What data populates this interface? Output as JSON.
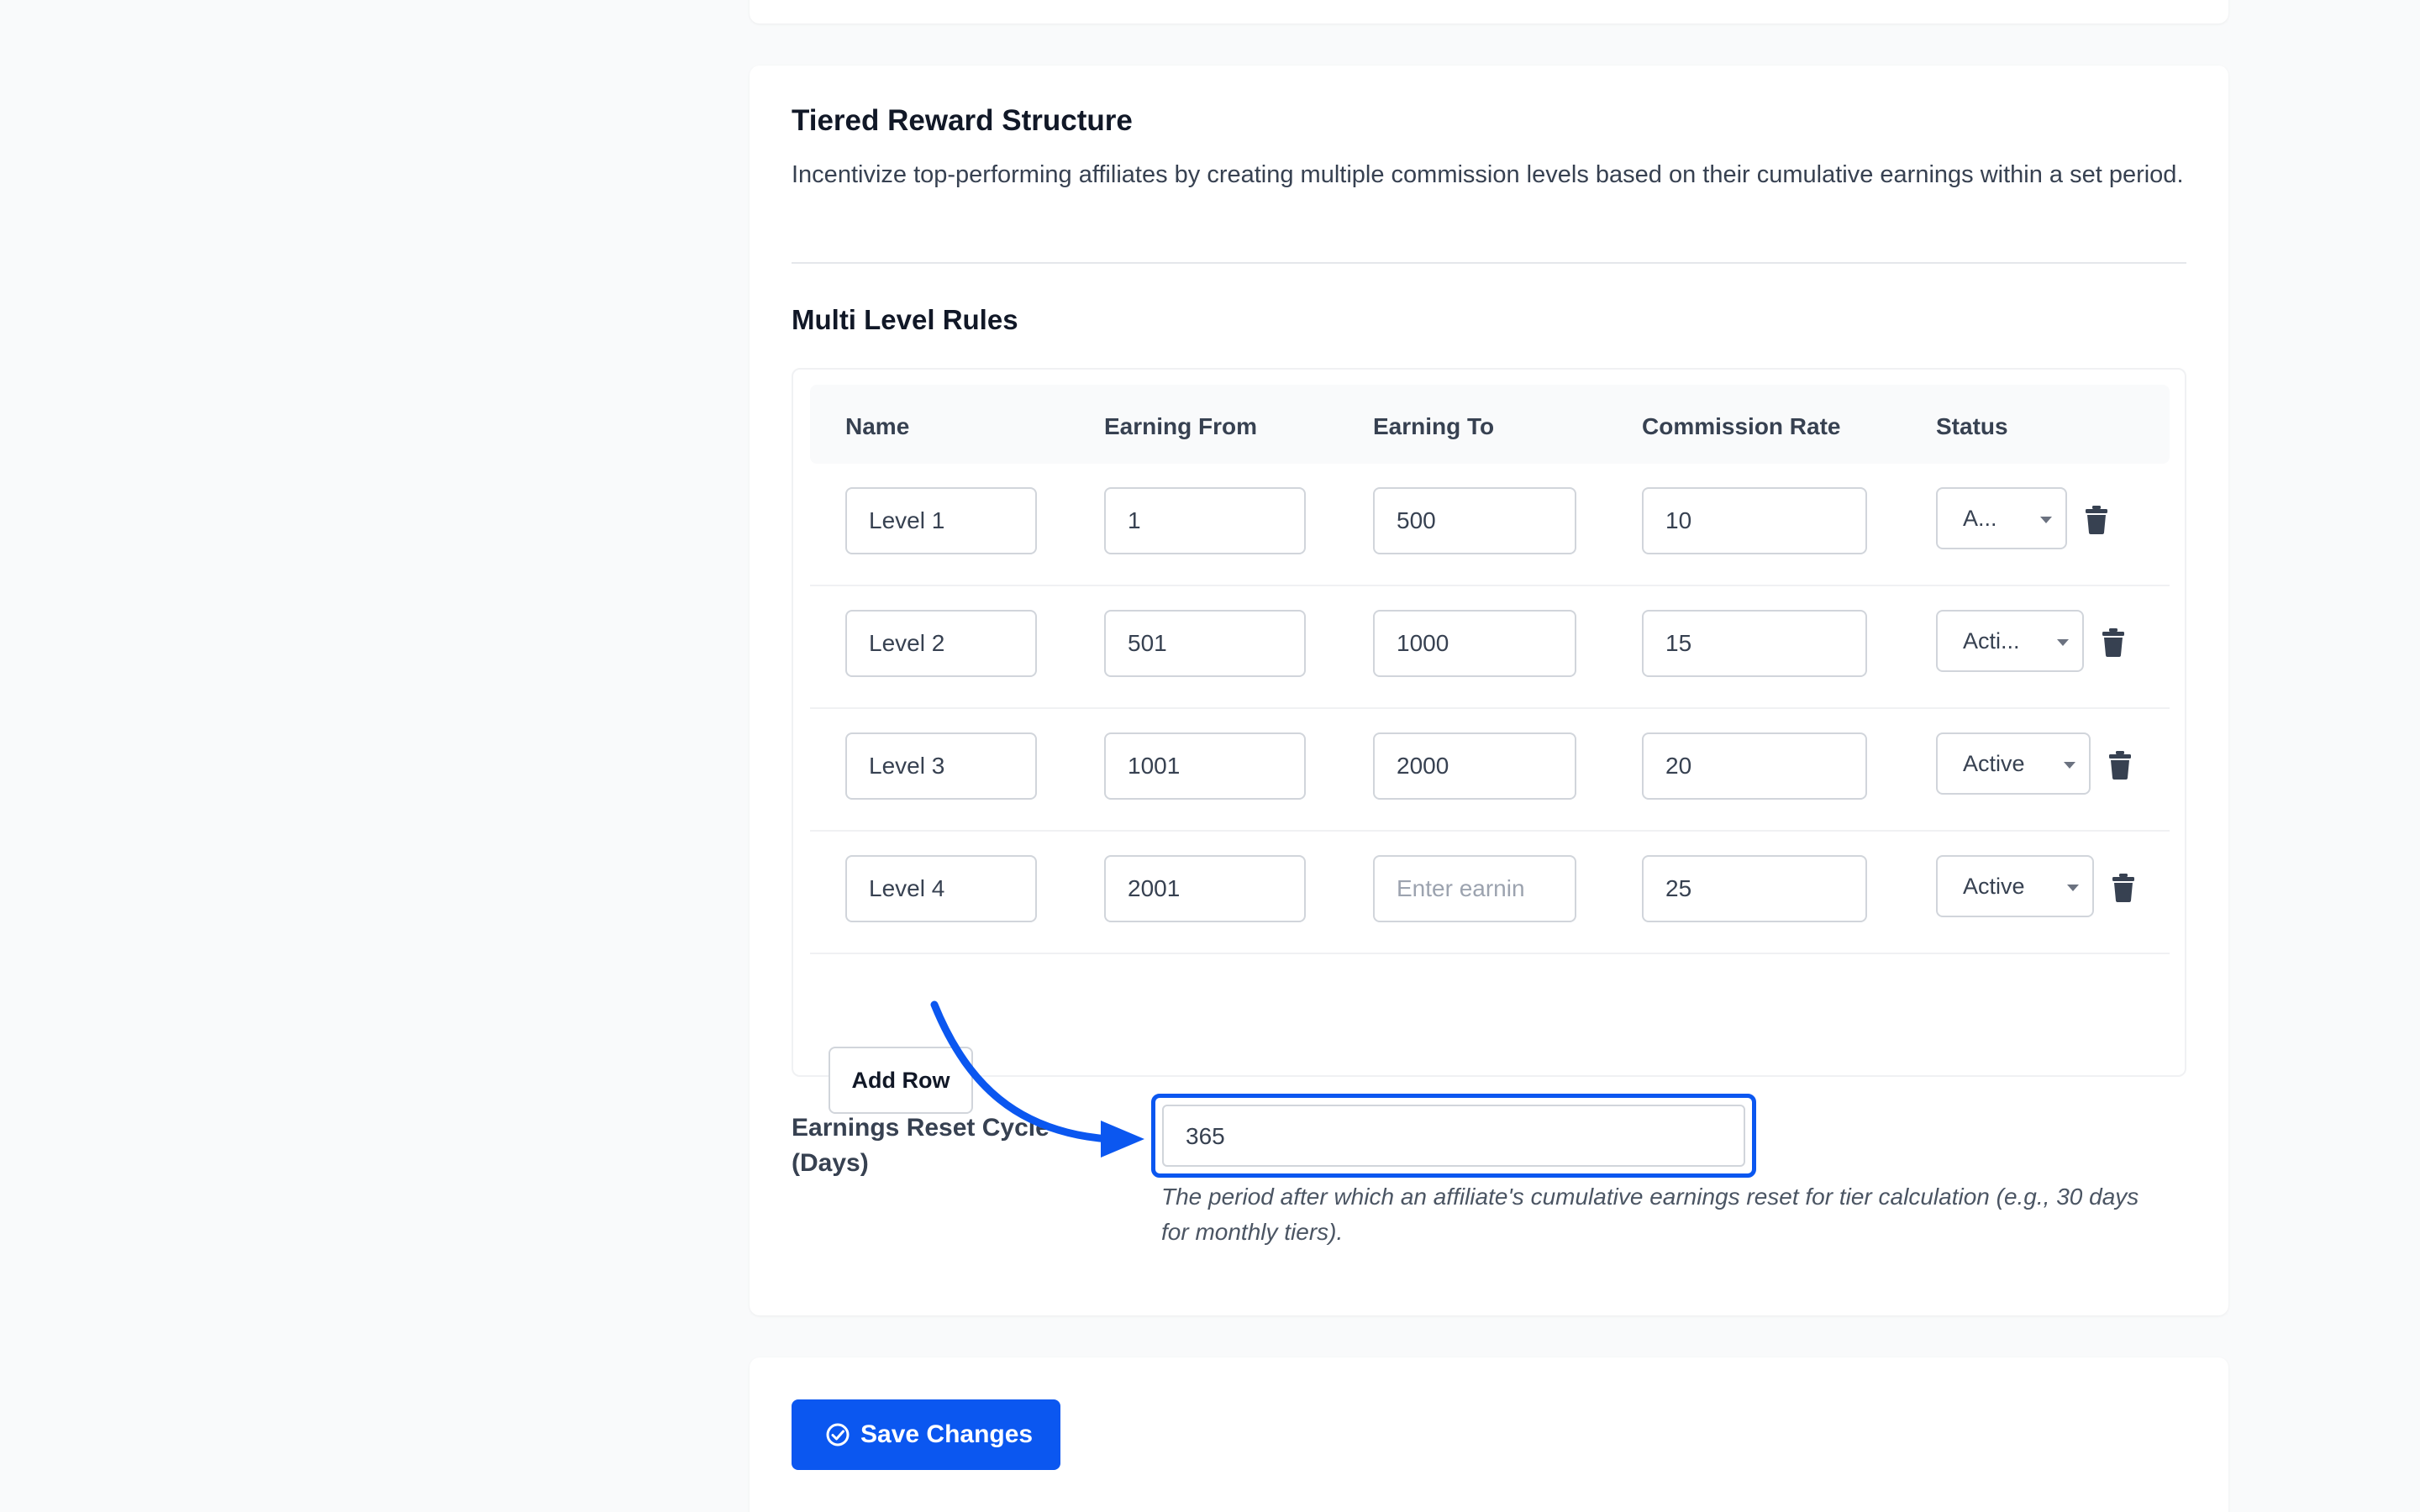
{
  "section": {
    "title": "Tiered Reward Structure",
    "description": "Incentivize top-performing affiliates by creating multiple commission levels based on their cumulative earnings within a set period."
  },
  "rules": {
    "title": "Multi Level Rules",
    "columns": [
      "Name",
      "Earning From",
      "Earning To",
      "Commission Rate",
      "Status"
    ],
    "rows": [
      {
        "name": "Level 1",
        "earning_from": "1",
        "earning_to": "500",
        "earning_to_placeholder": "",
        "commission_rate": "10",
        "status": "A..."
      },
      {
        "name": "Level 2",
        "earning_from": "501",
        "earning_to": "1000",
        "earning_to_placeholder": "",
        "commission_rate": "15",
        "status": "Acti..."
      },
      {
        "name": "Level 3",
        "earning_from": "1001",
        "earning_to": "2000",
        "earning_to_placeholder": "",
        "commission_rate": "20",
        "status": "Active"
      },
      {
        "name": "Level 4",
        "earning_from": "2001",
        "earning_to": "",
        "earning_to_placeholder": "Enter earnin",
        "commission_rate": "25",
        "status": "Active"
      }
    ],
    "add_row_label": "Add Row"
  },
  "reset_cycle": {
    "label_line1": "Earnings Reset Cycle",
    "label_line2": "(Days)",
    "value": "365",
    "help": "The period after which an affiliate's cumulative earnings reset for tier calculation (e.g., 30 days for monthly tiers)."
  },
  "footer": {
    "save_label": "Save Changes"
  },
  "colors": {
    "accent": "#0b57f0",
    "background": "#f9fafb",
    "trash_icon": "#374151"
  },
  "icons": {
    "delete": "trash-icon",
    "save": "check-circle-icon",
    "dropdown": "caret-down-icon"
  }
}
